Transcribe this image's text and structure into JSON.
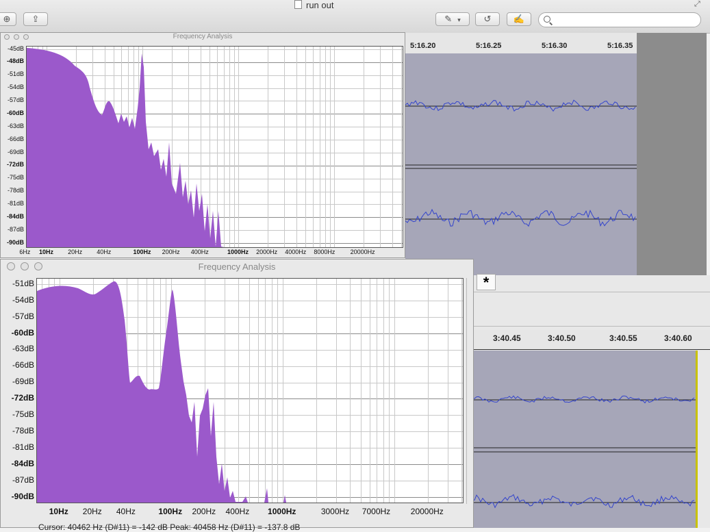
{
  "window": {
    "title": "run out"
  },
  "toolbar": {
    "search_placeholder": ""
  },
  "track1": {
    "time_labels": [
      "5:16.20",
      "5:16.25",
      "5:16.30",
      "5:16.35"
    ]
  },
  "track2": {
    "time_labels": [
      "3:40.45",
      "3:40.50",
      "3:40.55",
      "3:40.60"
    ],
    "asterisk": "*"
  },
  "colors": {
    "spectrum": "#9b59cb",
    "waveform": "#3344cc",
    "track_bg": "#a6a6b8"
  },
  "analysis_small": {
    "title": "Frequency Analysis",
    "db_labels": [
      "-45dB",
      "-48dB",
      "-51dB",
      "-54dB",
      "-57dB",
      "-60dB",
      "-63dB",
      "-66dB",
      "-69dB",
      "-72dB",
      "-75dB",
      "-78dB",
      "-81dB",
      "-84dB",
      "-87dB",
      "-90dB"
    ],
    "freq_labels": [
      "6Hz",
      "10Hz",
      "20Hz",
      "40Hz",
      "100Hz",
      "200Hz",
      "400Hz",
      "1000Hz",
      "2000Hz",
      "4000Hz",
      "8000Hz",
      "20000Hz"
    ]
  },
  "analysis_large": {
    "title": "Frequency Analysis",
    "db_labels": [
      "-51dB",
      "-54dB",
      "-57dB",
      "-60dB",
      "-63dB",
      "-66dB",
      "-69dB",
      "-72dB",
      "-75dB",
      "-78dB",
      "-81dB",
      "-84dB",
      "-87dB",
      "-90dB"
    ],
    "freq_labels": [
      "10Hz",
      "20Hz",
      "40Hz",
      "100Hz",
      "200Hz",
      "400Hz",
      "1000Hz",
      "3000Hz",
      "7000Hz",
      "20000Hz"
    ],
    "status": "Cursor: 40462 Hz (D#11) = -142 dB    Peak: 40458 Hz (D#11) = -137.8 dB"
  }
}
